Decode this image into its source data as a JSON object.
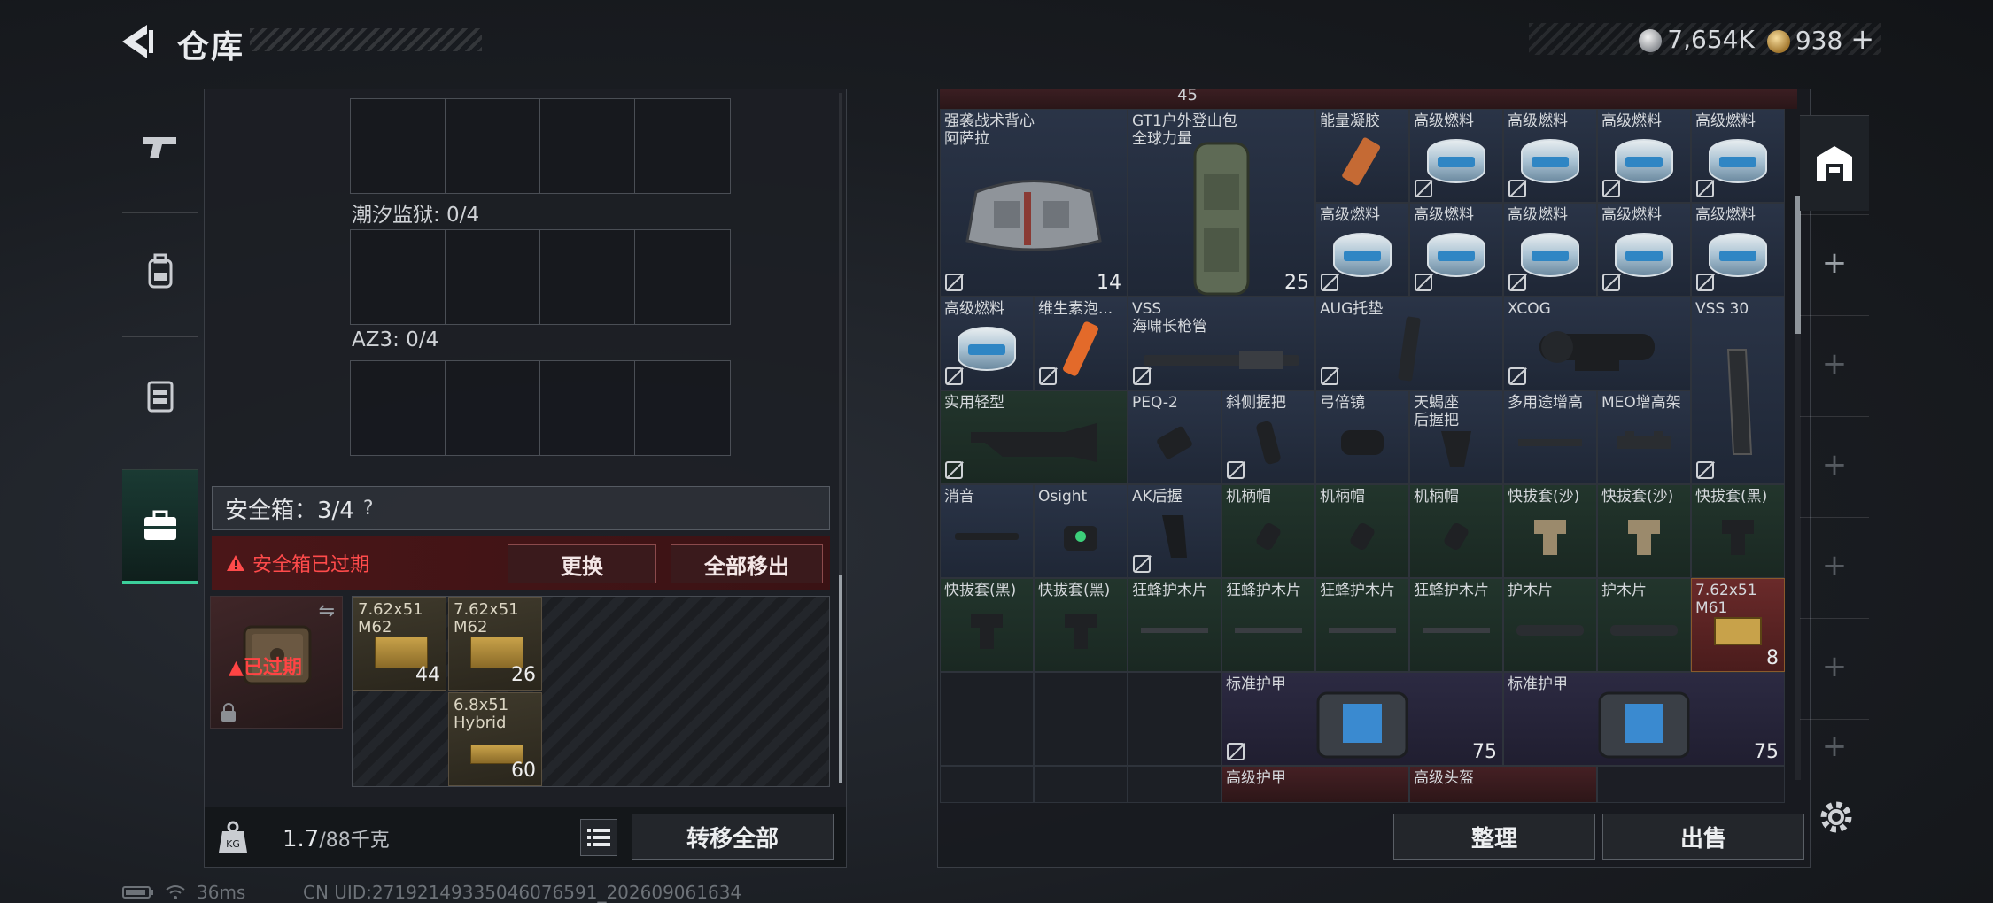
{
  "header": {
    "title": "仓库",
    "currency": [
      {
        "icon": "silver-coin-icon",
        "value": "7,654K"
      },
      {
        "icon": "gold-coin-icon",
        "value": "938"
      }
    ],
    "add_label": "+"
  },
  "left_tabs": [
    {
      "icon": "pistol-icon",
      "active": false
    },
    {
      "icon": "backpack-icon",
      "active": false
    },
    {
      "icon": "vest-icon",
      "active": false
    },
    {
      "icon": "case-icon",
      "active": true
    }
  ],
  "left_panel": {
    "containers": [
      {
        "label": ""
      },
      {
        "label": "潮汐监狱: 0/4"
      },
      {
        "label": "AZ3: 0/4"
      }
    ],
    "safebox": {
      "title": "安全箱：3/4",
      "help": "?",
      "expired_notice": "安全箱已过期",
      "replace_label": "更换",
      "remove_all_label": "全部移出",
      "case_status": "已过期",
      "items": [
        {
          "name": "7.62x51\nM62",
          "count": "44"
        },
        {
          "name": "7.62x51\nM62",
          "count": "26"
        },
        {
          "name": "6.8x51\nHybrid",
          "count": "60"
        }
      ]
    },
    "weight": {
      "value": "1.7",
      "unit": "/88千克"
    },
    "weight_icon_label": "KG",
    "transfer_all_label": "转移全部"
  },
  "stash": {
    "top_count": "45",
    "items": [
      {
        "name": "强袭战术背心\n阿萨拉",
        "durability": "14",
        "icon": "tactical-vest-icon"
      },
      {
        "name": "GT1户外登山包\n全球力量",
        "durability": "25",
        "icon": "backpack-icon"
      },
      {
        "name": "能量凝胶",
        "icon": "energy-gel-icon"
      },
      {
        "name": "高级燃料",
        "icon": "fuel-can-icon"
      },
      {
        "name": "高级燃料",
        "icon": "fuel-can-icon"
      },
      {
        "name": "高级燃料",
        "icon": "fuel-can-icon"
      },
      {
        "name": "高级燃料",
        "icon": "fuel-can-icon"
      },
      {
        "name": "高级燃料",
        "icon": "fuel-can-icon"
      },
      {
        "name": "高级燃料",
        "icon": "fuel-can-icon"
      },
      {
        "name": "高级燃料",
        "icon": "fuel-can-icon"
      },
      {
        "name": "高级燃料",
        "icon": "fuel-can-icon"
      },
      {
        "name": "高级燃料",
        "icon": "fuel-can-icon"
      },
      {
        "name": "高级燃料",
        "icon": "fuel-can-icon"
      },
      {
        "name": "维生素泡...",
        "icon": "vitamin-tube-icon"
      },
      {
        "name": "VSS\n海啸长枪管",
        "icon": "barrel-icon"
      },
      {
        "name": "AUG托垫",
        "icon": "stock-pad-icon"
      },
      {
        "name": "XCOG",
        "icon": "scope-icon"
      },
      {
        "name": "VSS 30",
        "icon": "magazine-icon"
      },
      {
        "name": "实用轻型",
        "icon": "stock-icon"
      },
      {
        "name": "PEQ-2",
        "icon": "laser-icon"
      },
      {
        "name": "斜侧握把",
        "icon": "grip-icon"
      },
      {
        "name": "弓倍镜",
        "icon": "sight-icon"
      },
      {
        "name": "天蝎座\n后握把",
        "icon": "pistol-grip-icon"
      },
      {
        "name": "多用途增高",
        "icon": "riser-icon"
      },
      {
        "name": "MEO增高架",
        "icon": "mount-icon"
      },
      {
        "name": "消音",
        "icon": "suppressor-icon"
      },
      {
        "name": "Osight",
        "icon": "red-dot-icon"
      },
      {
        "name": "AK后握",
        "icon": "ak-grip-icon"
      },
      {
        "name": "机柄帽",
        "icon": "handguard-cap-icon"
      },
      {
        "name": "机柄帽",
        "icon": "handguard-cap-icon"
      },
      {
        "name": "机柄帽",
        "icon": "handguard-cap-icon"
      },
      {
        "name": "快拔套(沙)",
        "icon": "holster-sand-icon"
      },
      {
        "name": "快拔套(沙)",
        "icon": "holster-sand-icon"
      },
      {
        "name": "快拔套(黑)",
        "icon": "holster-black-icon"
      },
      {
        "name": "快拔套(黑)",
        "icon": "holster-black-icon"
      },
      {
        "name": "快拔套(黑)",
        "icon": "holster-black-icon"
      },
      {
        "name": "狂蜂护木片",
        "icon": "rail-panel-icon"
      },
      {
        "name": "狂蜂护木片",
        "icon": "rail-panel-icon"
      },
      {
        "name": "狂蜂护木片",
        "icon": "rail-panel-icon"
      },
      {
        "name": "狂蜂护木片",
        "icon": "rail-panel-icon"
      },
      {
        "name": "护木片",
        "icon": "rail-cover-icon"
      },
      {
        "name": "护木片",
        "icon": "rail-cover-icon"
      },
      {
        "name": "7.62x51\nM61",
        "count": "8",
        "icon": "ammo-box-icon"
      },
      {
        "name": "标准护甲",
        "durability": "75",
        "icon": "body-armor-icon"
      },
      {
        "name": "标准护甲",
        "durability": "75",
        "icon": "body-armor-icon"
      },
      {
        "name": "高级护甲",
        "icon": "body-armor-icon"
      },
      {
        "name": "高级头盔",
        "icon": "helmet-icon"
      }
    ],
    "sort_label": "整理",
    "sell_label": "出售"
  },
  "right_rail": {
    "add_label": "+"
  },
  "status": {
    "ping": "36ms",
    "uid": "CN UID:27192149335046076591_202609061634"
  }
}
